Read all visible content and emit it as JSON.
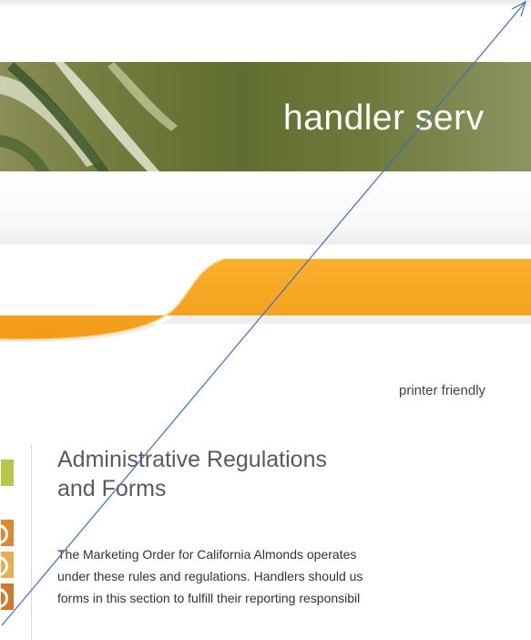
{
  "banner": {
    "title": "handler serv"
  },
  "printer_link": "printer friendly",
  "content": {
    "title_line1": "Administrative Regulations",
    "title_line2": "and Forms",
    "body_lines": [
      "The Marketing Order for California Almonds operates",
      "under these rules and regulations. Handlers should us",
      "forms in this section to fulfill their reporting responsibil"
    ]
  },
  "colors": {
    "banner_green": "#5f6e30",
    "orange": "#f7a623",
    "tab_green": "#b7c64a",
    "tab_orange": "#e0882d",
    "annotation_line": "#3a6ec4"
  }
}
